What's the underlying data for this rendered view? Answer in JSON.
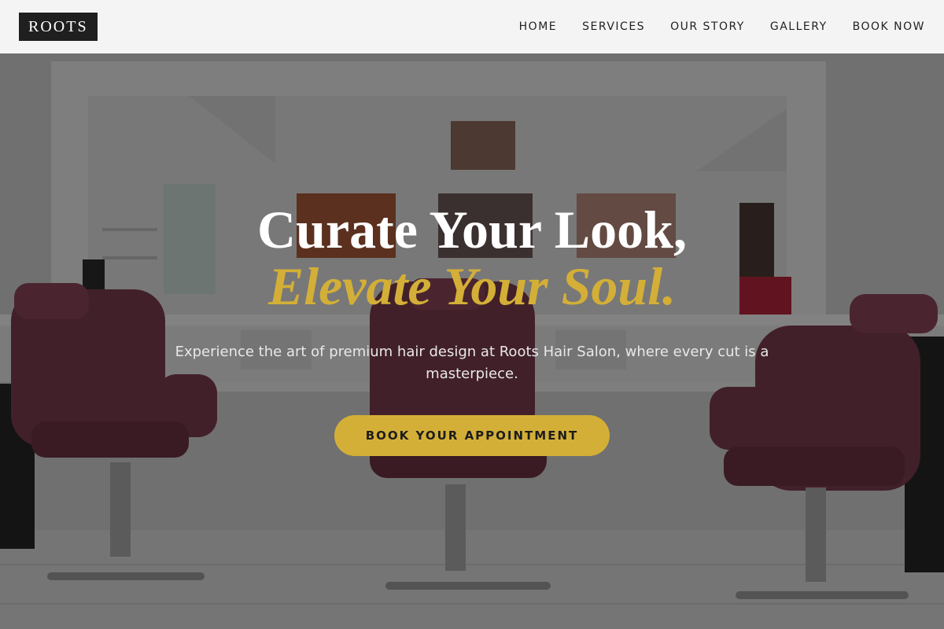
{
  "header": {
    "logo": "ROOTS",
    "nav": [
      "HOME",
      "SERVICES",
      "OUR STORY",
      "GALLERY",
      "BOOK NOW"
    ]
  },
  "hero": {
    "title_line1": "Curate Your Look,",
    "title_line2": "Elevate Your Soul.",
    "subtitle": "Experience the art of premium hair design at Roots Hair Salon, where every cut is a masterpiece.",
    "cta_label": "BOOK YOUR APPOINTMENT"
  },
  "colors": {
    "accent": "#d4af37",
    "header_bg": "#f4f4f4",
    "logo_bg": "#1f1f1f",
    "chair": "#7a3b4c"
  },
  "background_image": {
    "subject": "salon interior with three burgundy styling chairs, large wall mirror, framed portrait photos and product shelves"
  }
}
